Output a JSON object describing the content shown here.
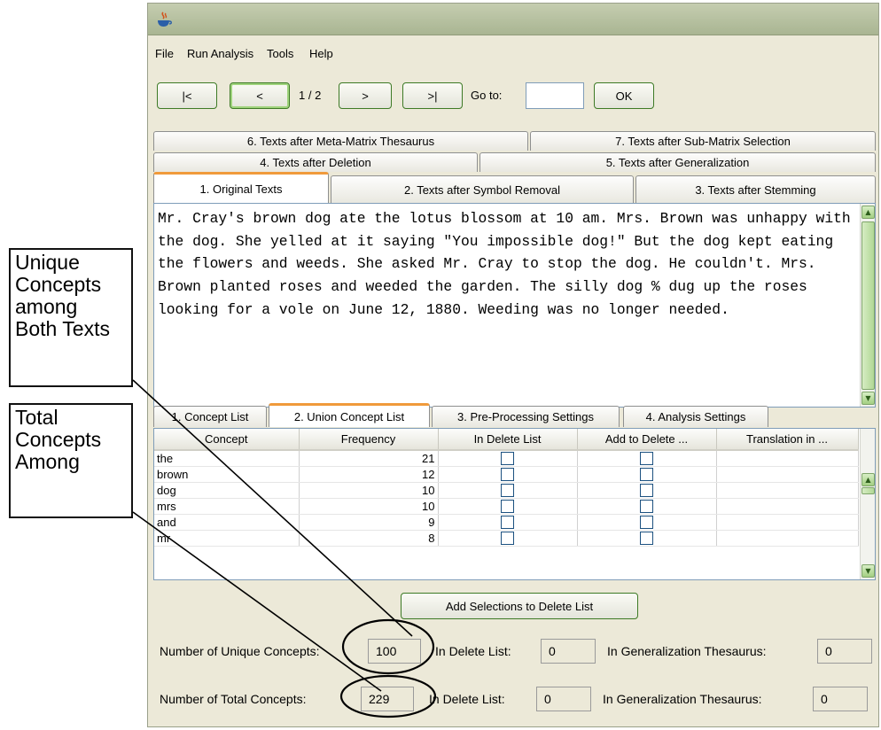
{
  "annotations": {
    "unique_label": [
      "Unique",
      "Concepts",
      "among",
      "Both Texts"
    ],
    "total_label": [
      "Total",
      "Concepts",
      "Among"
    ]
  },
  "menu": [
    "File",
    "Run Analysis",
    "Tools",
    "Help"
  ],
  "navigation": {
    "first": "|<",
    "prev": "<",
    "page": "1 / 2",
    "next": ">",
    "last": ">|",
    "goto_label": "Go to:",
    "goto_value": "",
    "ok": "OK"
  },
  "text_tabs": {
    "row1": [
      "6. Texts after Meta-Matrix Thesaurus",
      "7. Texts after Sub-Matrix Selection"
    ],
    "row2": [
      "4. Texts after Deletion",
      "5. Texts after Generalization"
    ],
    "row3": [
      "1. Original Texts",
      "2. Texts after Symbol Removal",
      "3. Texts after Stemming"
    ],
    "selected": "1. Original Texts"
  },
  "text_content": "Mr. Cray's brown dog ate the lotus blossom at 10 am. Mrs. Brown was unhappy with the dog. She yelled at it saying \"You impossible dog!\" But the dog kept eating the flowers and weeds. She asked Mr. Cray to stop the dog. He couldn't. Mrs. Brown planted roses and weeded the garden. The silly dog % dug up the roses looking for a vole on June 12, 1880. Weeding was no longer needed.",
  "lower_tabs": {
    "items": [
      "1. Concept List",
      "2. Union Concept List",
      "3. Pre-Processing Settings",
      "4. Analysis Settings"
    ],
    "selected": "2. Union Concept List"
  },
  "concept_table": {
    "columns": [
      "Concept",
      "Frequency",
      "In Delete List",
      "Add to Delete ...",
      "Translation in ..."
    ],
    "rows": [
      {
        "concept": "the",
        "frequency": "21",
        "in_delete": false,
        "add_delete": false,
        "translation": ""
      },
      {
        "concept": "brown",
        "frequency": "12",
        "in_delete": false,
        "add_delete": false,
        "translation": ""
      },
      {
        "concept": "dog",
        "frequency": "10",
        "in_delete": false,
        "add_delete": false,
        "translation": ""
      },
      {
        "concept": "mrs",
        "frequency": "10",
        "in_delete": false,
        "add_delete": false,
        "translation": ""
      },
      {
        "concept": "and",
        "frequency": "9",
        "in_delete": false,
        "add_delete": false,
        "translation": ""
      },
      {
        "concept": "mr",
        "frequency": "8",
        "in_delete": false,
        "add_delete": false,
        "translation": ""
      }
    ]
  },
  "add_button": "Add Selections to Delete List",
  "stats": {
    "unique_label": "Number of Unique Concepts:",
    "unique_value": "100",
    "unique_delete_label": "In Delete List:",
    "unique_delete_value": "0",
    "unique_gen_label": "In Generalization Thesaurus:",
    "unique_gen_value": "0",
    "total_label": "Number of Total Concepts:",
    "total_value": "229",
    "total_delete_label": "In Delete List:",
    "total_delete_value": "0",
    "total_gen_label": "In Generalization Thesaurus:",
    "total_gen_value": "0"
  },
  "colors": {
    "window_bg": "#ece9d8",
    "tab_accent": "#f09a3b",
    "button_border": "#3d7a25",
    "field_border": "#7f9db9"
  }
}
